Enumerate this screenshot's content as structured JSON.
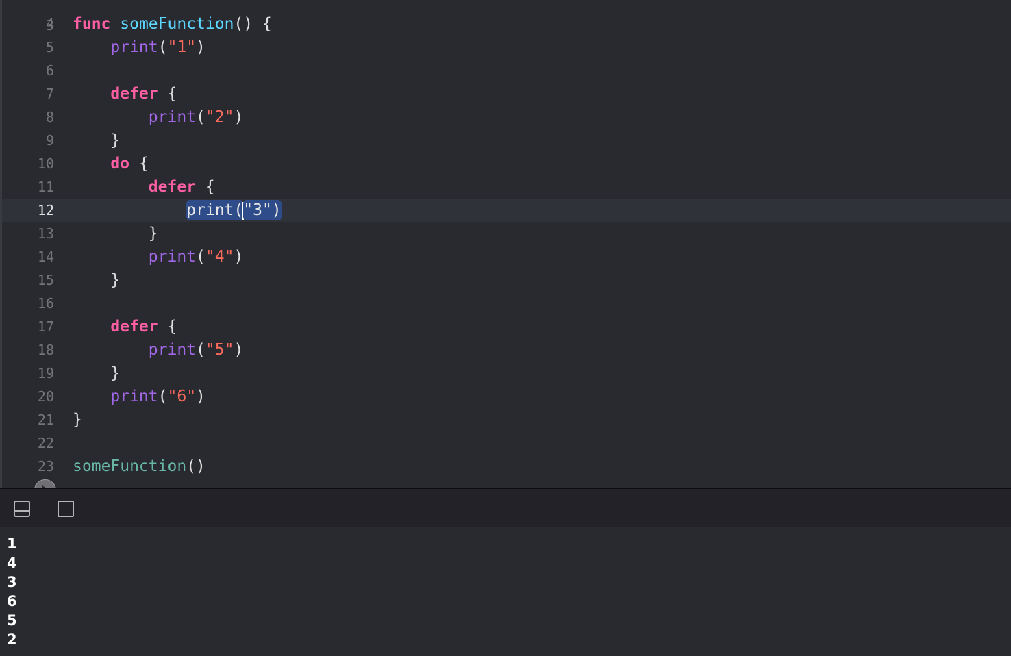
{
  "editor": {
    "top_partial_line_number": "3",
    "current_line": "12",
    "lines": [
      {
        "n": "4",
        "tokens": [
          [
            "kw",
            "func"
          ],
          [
            "p",
            " "
          ],
          [
            "fn-decl",
            "someFunction"
          ],
          [
            "p",
            "() {"
          ]
        ]
      },
      {
        "n": "5",
        "tokens": [
          [
            "p",
            "    "
          ],
          [
            "pr",
            "print"
          ],
          [
            "p",
            "("
          ],
          [
            "str",
            "\"1\""
          ],
          [
            "p",
            ")"
          ]
        ]
      },
      {
        "n": "6",
        "tokens": []
      },
      {
        "n": "7",
        "tokens": [
          [
            "p",
            "    "
          ],
          [
            "kw",
            "defer"
          ],
          [
            "p",
            " {"
          ]
        ]
      },
      {
        "n": "8",
        "tokens": [
          [
            "p",
            "        "
          ],
          [
            "pr",
            "print"
          ],
          [
            "p",
            "("
          ],
          [
            "str",
            "\"2\""
          ],
          [
            "p",
            ")"
          ]
        ]
      },
      {
        "n": "9",
        "tokens": [
          [
            "p",
            "    }"
          ]
        ]
      },
      {
        "n": "10",
        "tokens": [
          [
            "p",
            "    "
          ],
          [
            "kw",
            "do"
          ],
          [
            "p",
            " {"
          ]
        ]
      },
      {
        "n": "11",
        "tokens": [
          [
            "p",
            "        "
          ],
          [
            "kw",
            "defer"
          ],
          [
            "p",
            " {"
          ]
        ]
      },
      {
        "n": "12",
        "tokens": [
          [
            "p",
            "            "
          ],
          [
            "sel",
            "print("
          ],
          [
            "caret",
            ""
          ],
          [
            "sel",
            "\"3\")"
          ]
        ]
      },
      {
        "n": "13",
        "tokens": [
          [
            "p",
            "        }"
          ]
        ]
      },
      {
        "n": "14",
        "tokens": [
          [
            "p",
            "        "
          ],
          [
            "pr",
            "print"
          ],
          [
            "p",
            "("
          ],
          [
            "str",
            "\"4\""
          ],
          [
            "p",
            ")"
          ]
        ]
      },
      {
        "n": "15",
        "tokens": [
          [
            "p",
            "    }"
          ]
        ]
      },
      {
        "n": "16",
        "tokens": []
      },
      {
        "n": "17",
        "tokens": [
          [
            "p",
            "    "
          ],
          [
            "kw",
            "defer"
          ],
          [
            "p",
            " {"
          ]
        ]
      },
      {
        "n": "18",
        "tokens": [
          [
            "p",
            "        "
          ],
          [
            "pr",
            "print"
          ],
          [
            "p",
            "("
          ],
          [
            "str",
            "\"5\""
          ],
          [
            "p",
            ")"
          ]
        ]
      },
      {
        "n": "19",
        "tokens": [
          [
            "p",
            "    }"
          ]
        ]
      },
      {
        "n": "20",
        "tokens": [
          [
            "p",
            "    "
          ],
          [
            "pr",
            "print"
          ],
          [
            "p",
            "("
          ],
          [
            "str",
            "\"6\""
          ],
          [
            "p",
            ")"
          ]
        ]
      },
      {
        "n": "21",
        "tokens": [
          [
            "p",
            "}"
          ]
        ]
      },
      {
        "n": "22",
        "tokens": []
      },
      {
        "n": "23",
        "tokens": [
          [
            "fn",
            "someFunction"
          ],
          [
            "p",
            "()"
          ]
        ]
      }
    ]
  },
  "debug_bar": {
    "icons": [
      "hide-debug-area-icon",
      "toggle-layout-icon"
    ]
  },
  "console": {
    "output": [
      "1",
      "4",
      "3",
      "6",
      "5",
      "2"
    ]
  },
  "colors": {
    "keyword": "#fc5fa3",
    "function_call": "#67b7a4",
    "function_declaration": "#5dd8ff",
    "builtin": "#a167e6",
    "string": "#fc6a5d",
    "selection": "#2f4c8a",
    "background": "#292a30"
  }
}
